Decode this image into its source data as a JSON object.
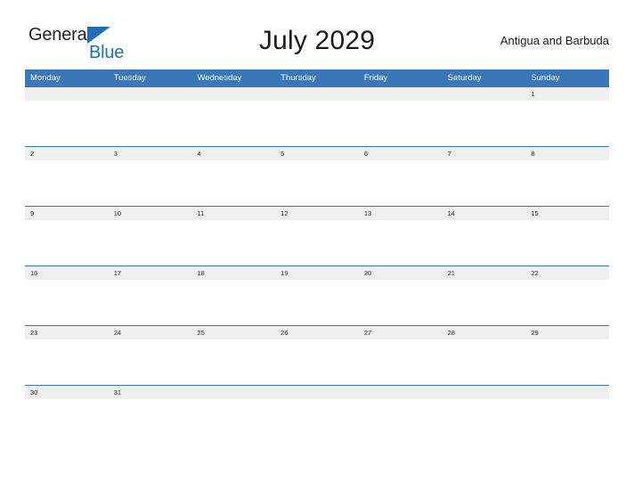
{
  "logo": {
    "word_one": "General",
    "word_two": "Blue",
    "triangle_icon": "blue-triangle-icon",
    "color_dark": "#231f20",
    "color_blue": "#1f6fb2"
  },
  "header": {
    "title": "July 2029",
    "country": "Antigua and Barbuda"
  },
  "theme": {
    "header_blue": "#3b76b8",
    "row_line_blue": "#3b76b8",
    "band_gray": "#efefef",
    "page_background": "#ffffff",
    "date_text": "#333333",
    "title_text": "#1a1a1a"
  },
  "calendar": {
    "month": "July",
    "year": "2029",
    "weekday_headers": [
      "Monday",
      "Tuesday",
      "Wednesday",
      "Thursday",
      "Friday",
      "Saturday",
      "Sunday"
    ],
    "weeks": [
      {
        "days": [
          "",
          "",
          "",
          "",
          "",
          "",
          "1"
        ]
      },
      {
        "days": [
          "2",
          "3",
          "4",
          "5",
          "6",
          "7",
          "8"
        ]
      },
      {
        "days": [
          "9",
          "10",
          "11",
          "12",
          "13",
          "14",
          "15"
        ]
      },
      {
        "days": [
          "16",
          "17",
          "18",
          "19",
          "20",
          "21",
          "22"
        ]
      },
      {
        "days": [
          "23",
          "24",
          "25",
          "26",
          "27",
          "28",
          "29"
        ]
      },
      {
        "days": [
          "30",
          "31",
          "",
          "",
          "",
          "",
          ""
        ]
      }
    ]
  }
}
